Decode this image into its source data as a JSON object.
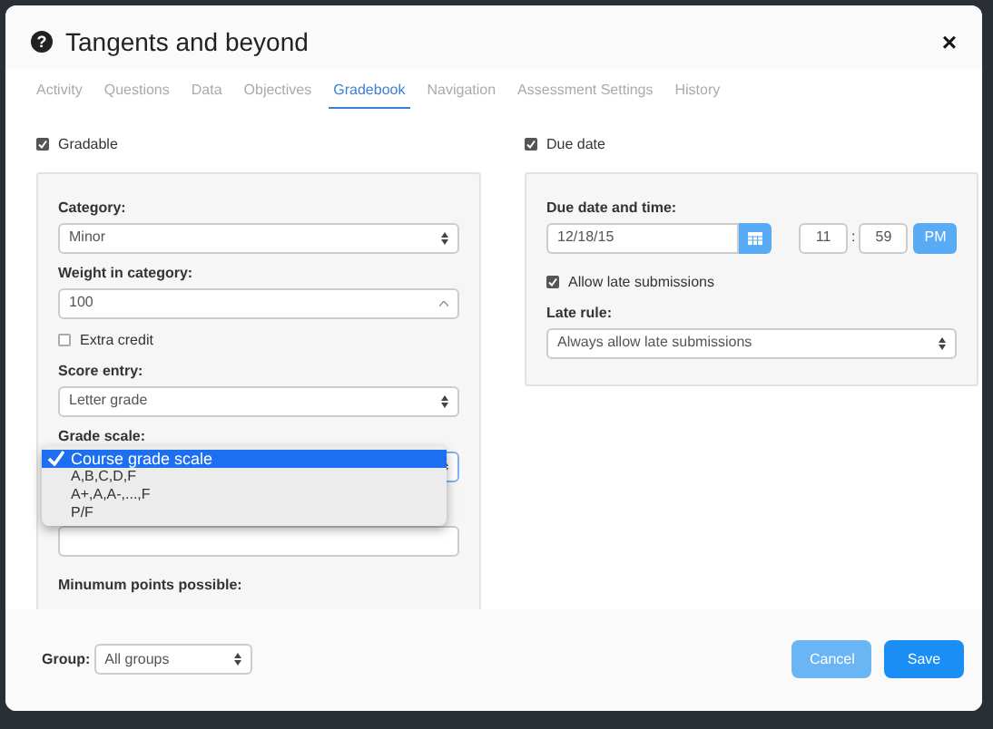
{
  "dialog": {
    "help": "?",
    "title": "Tangents and beyond",
    "close": "×"
  },
  "tabs": [
    {
      "label": "Activity",
      "selected": false
    },
    {
      "label": "Questions",
      "selected": false
    },
    {
      "label": "Data",
      "selected": false
    },
    {
      "label": "Objectives",
      "selected": false
    },
    {
      "label": "Gradebook",
      "selected": true
    },
    {
      "label": "Navigation",
      "selected": false
    },
    {
      "label": "Assessment Settings",
      "selected": false
    },
    {
      "label": "History",
      "selected": false
    }
  ],
  "gradable": {
    "label": "Gradable",
    "checked": true
  },
  "grading_fields": [
    {
      "kind": "select",
      "label": "Category:",
      "value": "Minor"
    },
    {
      "kind": "number",
      "label": "Weight in category:",
      "value": "100"
    },
    {
      "kind": "checkbox",
      "label": "Extra credit",
      "checked": false
    },
    {
      "kind": "select",
      "label": "Score entry:",
      "value": "Letter grade"
    },
    {
      "kind": "menu",
      "label": "Grade scale:",
      "options": [
        {
          "label": "Course grade scale",
          "selected": true
        },
        {
          "label": "A,B,C,D,F",
          "selected": false
        },
        {
          "label": "A+,A,A-,...,F",
          "selected": false
        },
        {
          "label": "P/F",
          "selected": false
        }
      ]
    },
    {
      "kind": "input"
    },
    {
      "kind": "heading",
      "label": "Minumum points possible:"
    }
  ],
  "due_date": {
    "label": "Due date",
    "checked": true
  },
  "due_fields": {
    "label": "Due date and time:",
    "date": "12/18/15",
    "hour": "11",
    "separator": ":",
    "minute": "59",
    "meridiem": "PM",
    "allow_late": {
      "label": "Allow late submissions",
      "checked": true
    },
    "late_rule_label": "Late rule:",
    "late_rule": "Always allow late submissions"
  },
  "footer": {
    "group_label": "Group:",
    "group": "All groups",
    "buttons": [
      {
        "label": "Cancel",
        "kind": "muted"
      },
      {
        "label": "Save",
        "kind": "primary"
      }
    ]
  }
}
